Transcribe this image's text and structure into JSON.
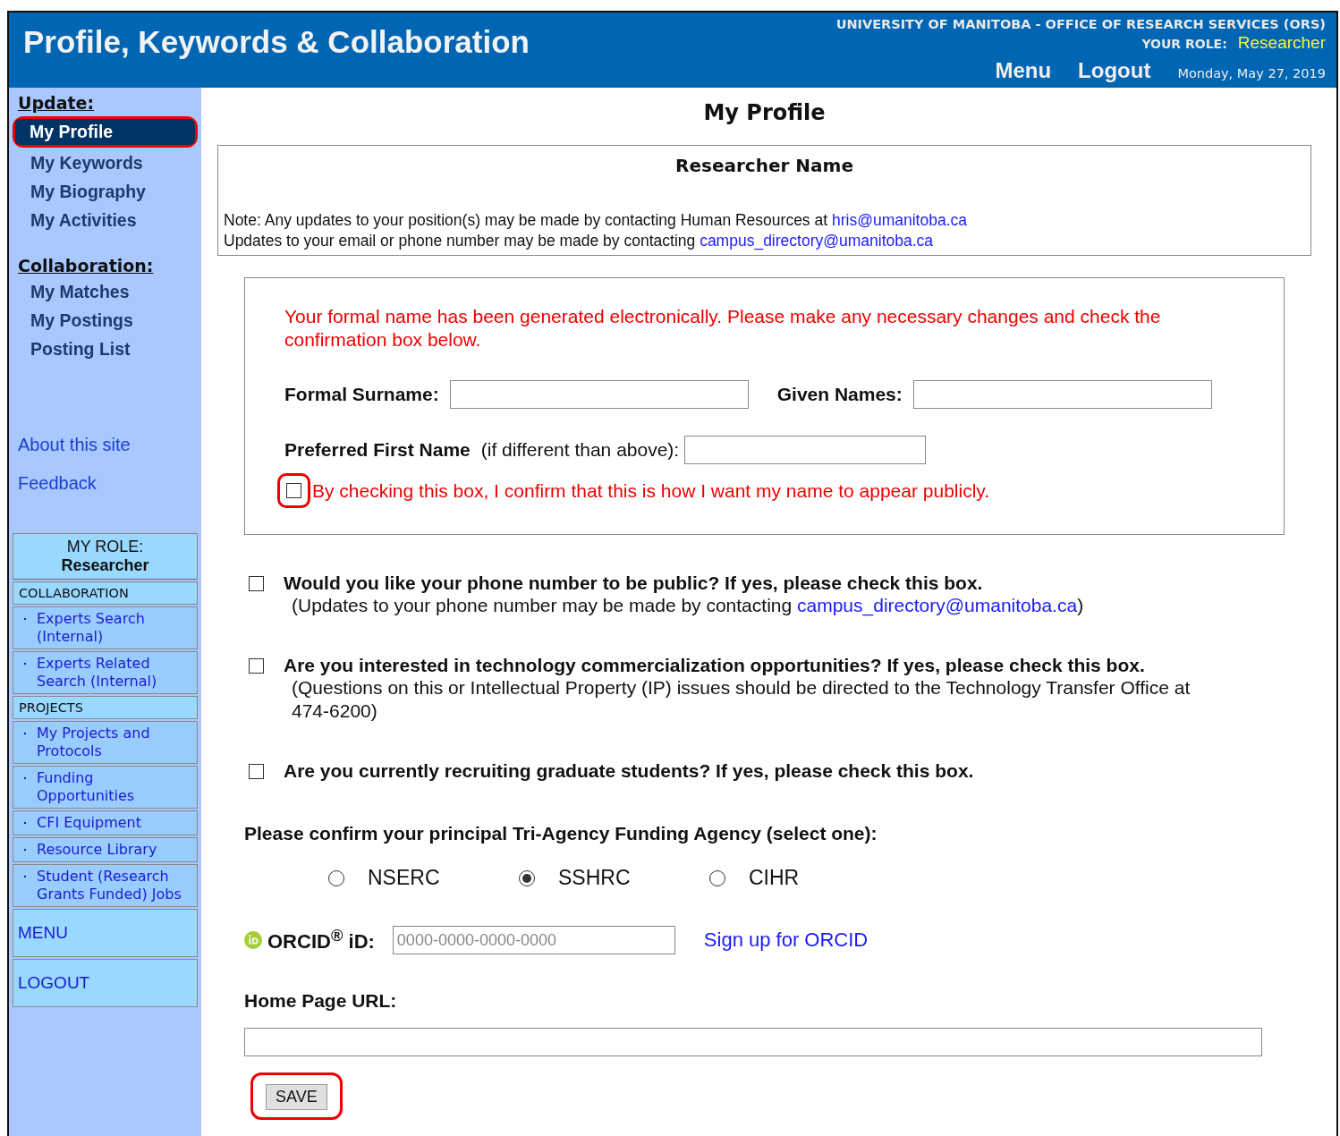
{
  "header": {
    "title": "Profile, Keywords & Collaboration",
    "org": "UNIVERSITY OF MANITOBA - OFFICE OF RESEARCH SERVICES (ORS)",
    "role_label": "YOUR ROLE:",
    "role": "Researcher",
    "links": [
      "Menu",
      "Logout"
    ],
    "date": "Monday, May 27, 2019"
  },
  "sidebar": {
    "sections": [
      {
        "heading": "Update:",
        "items": [
          {
            "label": "My Profile",
            "selected": true
          },
          {
            "label": "My Keywords",
            "selected": false
          },
          {
            "label": "My Biography",
            "selected": false
          },
          {
            "label": "My Activities",
            "selected": false
          }
        ]
      },
      {
        "heading": "Collaboration:",
        "items": [
          {
            "label": "My Matches",
            "selected": false
          },
          {
            "label": "My Postings",
            "selected": false
          },
          {
            "label": "Posting List",
            "selected": false
          }
        ]
      }
    ],
    "links": [
      "About this site",
      "Feedback"
    ],
    "role_box": {
      "label": "MY ROLE:",
      "role": "Researcher"
    },
    "groups": [
      {
        "heading": "COLLABORATION",
        "items": [
          "Experts Search (Internal)",
          "Experts Related Search (Internal)"
        ]
      },
      {
        "heading": "PROJECTS",
        "items": [
          "My Projects and Protocols",
          "Funding Opportunities",
          "CFI Equipment",
          "Resource Library",
          "Student (Research Grants Funded) Jobs"
        ]
      }
    ],
    "bottom_links": [
      "MENU",
      "LOGOUT"
    ]
  },
  "main": {
    "title": "My Profile",
    "name_box": {
      "title": "Researcher Name",
      "notes": [
        {
          "text": "Note: Any updates to your position(s) may be made by contacting Human Resources at",
          "link": "hris@umanitoba.ca"
        },
        {
          "text": "Updates to your email or phone number may be made by contacting",
          "link": "campus_directory@umanitoba.ca"
        }
      ]
    },
    "formal": {
      "warning": "Your formal name has been generated electronically. Please make any necessary changes and check the confirmation box below.",
      "surname_label": "Formal Surname:",
      "given_label": "Given Names:",
      "preferred_label": "Preferred First Name",
      "preferred_hint": "(if different than above):",
      "confirm": {
        "label": "By checking this box, I confirm that this is how I want my name to appear publicly.",
        "checked": false
      }
    },
    "questions": [
      {
        "label": "Would you like your phone number to be public? If yes, please check this box.",
        "checked": false,
        "note": "(Updates to your phone number may be made by contacting",
        "note_link": "campus_directory@umanitoba.ca",
        "note_end": ")"
      },
      {
        "label": "Are you interested in technology commercialization opportunities? If yes, please check this box.",
        "checked": false,
        "note": "(Questions on this or Intellectual Property (IP) issues should be directed to the Technology Transfer Office at 474-6200)"
      },
      {
        "label": "Are you currently recruiting graduate students? If yes, please check this box.",
        "checked": false
      }
    ],
    "agency": {
      "label": "Please confirm your principal Tri-Agency Funding Agency (select one):",
      "options": [
        {
          "label": "NSERC",
          "selected": false
        },
        {
          "label": "SSHRC",
          "selected": true
        },
        {
          "label": "CIHR",
          "selected": false
        }
      ]
    },
    "orcid": {
      "label": "ORCID$^{®}$ iD:",
      "placeholder": "0000-0000-0000-0000",
      "link": "Sign up for ORCID"
    },
    "homepage": {
      "label": "Home Page URL:"
    },
    "save": "SAVE"
  }
}
